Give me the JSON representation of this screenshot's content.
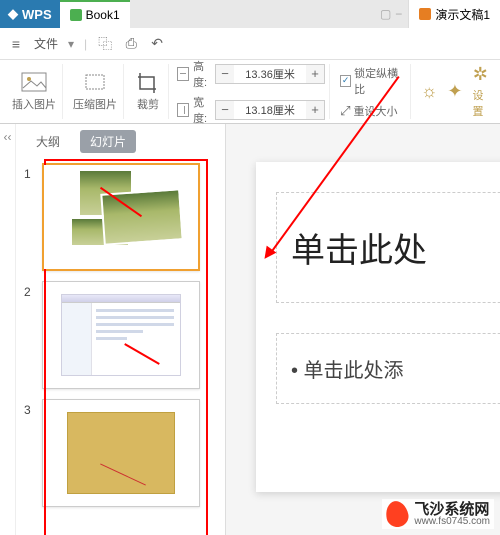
{
  "tabs": {
    "wps": "WPS",
    "book": "Book1",
    "pres": "演示文稿1"
  },
  "menubar": {
    "file": "文件"
  },
  "ribbon": {
    "insert_pic": "插入图片",
    "compress": "压缩图片",
    "crop": "裁剪",
    "height_label": "高度:",
    "width_label": "宽度:",
    "height_val": "13.36厘米",
    "width_val": "13.18厘米",
    "lock_ratio": "锁定纵横比",
    "reset_size": "重设大小",
    "settings": "设置"
  },
  "slidepanel": {
    "outline": "大纲",
    "slides": "幻灯片",
    "nums": [
      "1",
      "2",
      "3"
    ]
  },
  "canvas": {
    "title_ph": "单击此处",
    "body_ph": "• 单击此处添"
  },
  "watermark": {
    "name": "飞沙系统网",
    "url": "www.fs0745.com"
  }
}
